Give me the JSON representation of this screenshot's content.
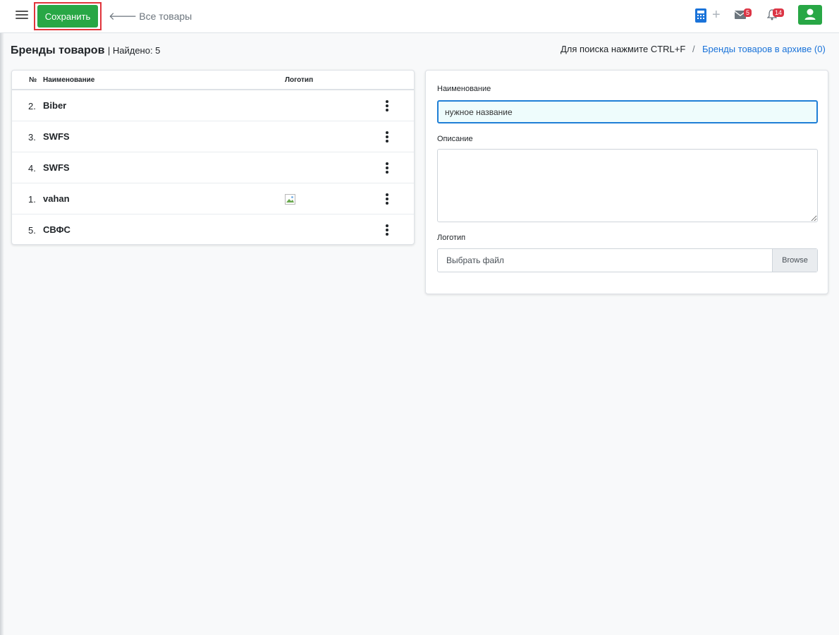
{
  "toolbar": {
    "save_label": "Сохранить",
    "back_label": "Все товары",
    "mail_count": "5",
    "notif_count": "14"
  },
  "header": {
    "title": "Бренды товаров",
    "found": "| Найдено: 5",
    "search_hint": "Для поиска нажмите CTRL+F",
    "separator": "/",
    "archive_link": "Бренды товаров в архиве (0)"
  },
  "table": {
    "columns": {
      "num": "№",
      "name": "Наименование",
      "logo": "Логотип"
    },
    "rows": [
      {
        "num": "2.",
        "name": "Biber"
      },
      {
        "num": "3.",
        "name": "SWFS"
      },
      {
        "num": "4.",
        "name": "SWFS"
      },
      {
        "num": "1.",
        "name": "vahan"
      },
      {
        "num": "5.",
        "name": "СВФС"
      }
    ]
  },
  "form": {
    "name_label": "Наименование",
    "name_value": "нужное название",
    "desc_label": "Описание",
    "desc_value": "",
    "logo_label": "Логотип",
    "file_placeholder": "Выбрать файл",
    "browse_label": "Browse"
  },
  "colors": {
    "accent": "#28a745",
    "link": "#1a73d9",
    "badge": "#dc3545",
    "highlight": "#e0343b"
  }
}
